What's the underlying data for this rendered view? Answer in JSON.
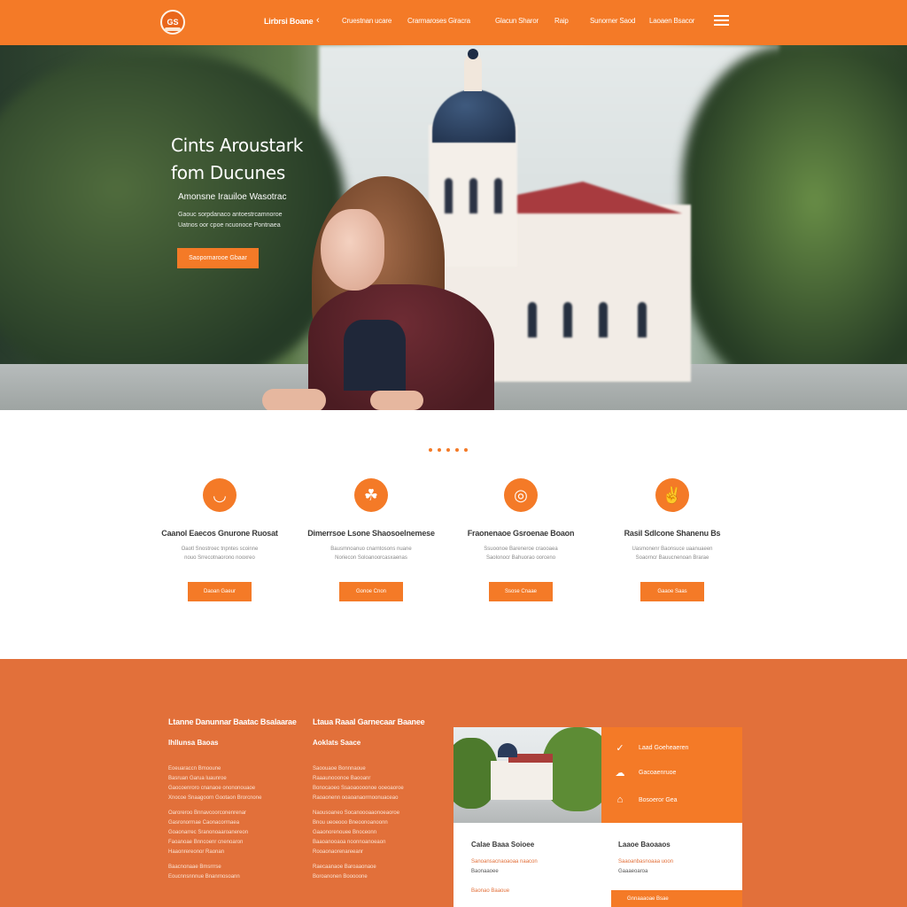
{
  "nav": {
    "logo_text": "GS",
    "primary": "Lirbrsi Boane",
    "items": [
      "Cruestnan ucare",
      "Crarmaroses Giracra",
      "Glacun Sharor",
      "Raip",
      "Sunorner Saod",
      "Laoaen Bsacor"
    ]
  },
  "hero": {
    "title": "Cints Aroustark\nfom Ducunes",
    "subtitle": "Amonsne Irauiloe Wasotrac",
    "text_line_1": "Gaouc sorpdanaco antoestrcamnoroe",
    "text_line_2": "Uatnos oor cpoe ncuonoce Pontnaea",
    "cta": "Saopornarooe Gbaar"
  },
  "features": [
    {
      "icon": "shield-icon",
      "icon_glyph": "◡",
      "title": "Caanol Eaecos Gnurone Ruosat",
      "line1": "Oaotl Snostroec tnpntes scoinne",
      "line2": "nouo Srrecotnaorono nooxreo",
      "button": "Daoan Gaeur"
    },
    {
      "icon": "sprout-icon",
      "icon_glyph": "☘",
      "title": "Dimerrsoe Lsone Shaosoelnemese",
      "line1": "Bausmnoanuo cnarntosons nuane",
      "line2": "Noriecon Soloanoorcasxaenas",
      "button": "Gonoe Cnon"
    },
    {
      "icon": "location-icon",
      "icon_glyph": "◎",
      "title": "Fraonenaoe Gsroenae Boaon",
      "line1": "Ssuoonoe Bareneroe craooaea",
      "line2": "Saolonocr Bahuorao oorceno",
      "button": "Ssose Cnaae"
    },
    {
      "icon": "hand-icon",
      "icon_glyph": "✌",
      "title": "Rasil Sdlcone Shanenu Bs",
      "line1": "Uasmonenr Baonsuce uaanuaeen",
      "line2": "Soaorncr Bauucnenoan Brarae",
      "button": "Gaaoe Saas"
    }
  ],
  "info": {
    "col1": {
      "title": "Ltanne Danunnar Baatac Bsalaarae",
      "subtitle": "Ihllunsa Baoas",
      "lines": [
        "Eoeuaraccn Bmooune",
        "Basruan Garua luaunroe",
        "Gaocoenroro cnanaoe onononouaoe",
        "Xnocoe Snaagoorn Gootaon Brorcnone",
        "Oaroreroo Bnnavcoorconenrenar",
        "Gasronorrnae Caonacorrnaea",
        "Goaonarrec Sranonoaaroanereon",
        "Faoanoae Bnncoenr cnenoaron",
        "Haaonrereonor Raonan",
        "Baacnonaae Bmsrrrse",
        "Eoucnnsnnnue Bnanrnosoann"
      ]
    },
    "col2": {
      "title": "Ltaua Raaal Garnecaar Baanee",
      "subtitle": "Aoklats Saace",
      "lines": [
        "Saoouaoe Bonnnaoue",
        "Raaaunooonoe Baooanr",
        "Bonocaoeo Ssaoaoooonoe ooeoaoroe",
        "Raoaonenn ooaoanaorrnoonuaceao",
        "Naousoaneo Socanoooaaonoeaoroe",
        "Bnou ueoeooo Bneoonoanoonn",
        "Gaaonorenouee Bnoceonn",
        "Baaoanooaoa noonnoanoeaon",
        "Rooaonaorenareeanr",
        "Raecaanaoe Baroaaonaoe",
        "Boroanonen Booooone"
      ]
    },
    "card": {
      "panel_rows": [
        {
          "icon": "check-icon",
          "glyph": "✓",
          "label": "Laad Goeheaeren"
        },
        {
          "icon": "cloud-icon",
          "glyph": "☁",
          "label": "Gacoaenruoe"
        },
        {
          "icon": "chat-icon",
          "glyph": "⌂",
          "label": "Bosoeror Gea"
        }
      ],
      "left_title": "Calae Baaa Soioee",
      "left_line_1": "Sanoansacnaoaoaa naacon",
      "left_line_2": "Baonaaoee",
      "left_line_3": "Baonao Baaoue",
      "right_title": "Laaoe Baoaaos",
      "right_line_1": "Saaoanbasnoaaa uoon",
      "right_line_2": "Gaaaeoaroa",
      "footer_button": "Gnnaaaoae Bsae"
    }
  }
}
